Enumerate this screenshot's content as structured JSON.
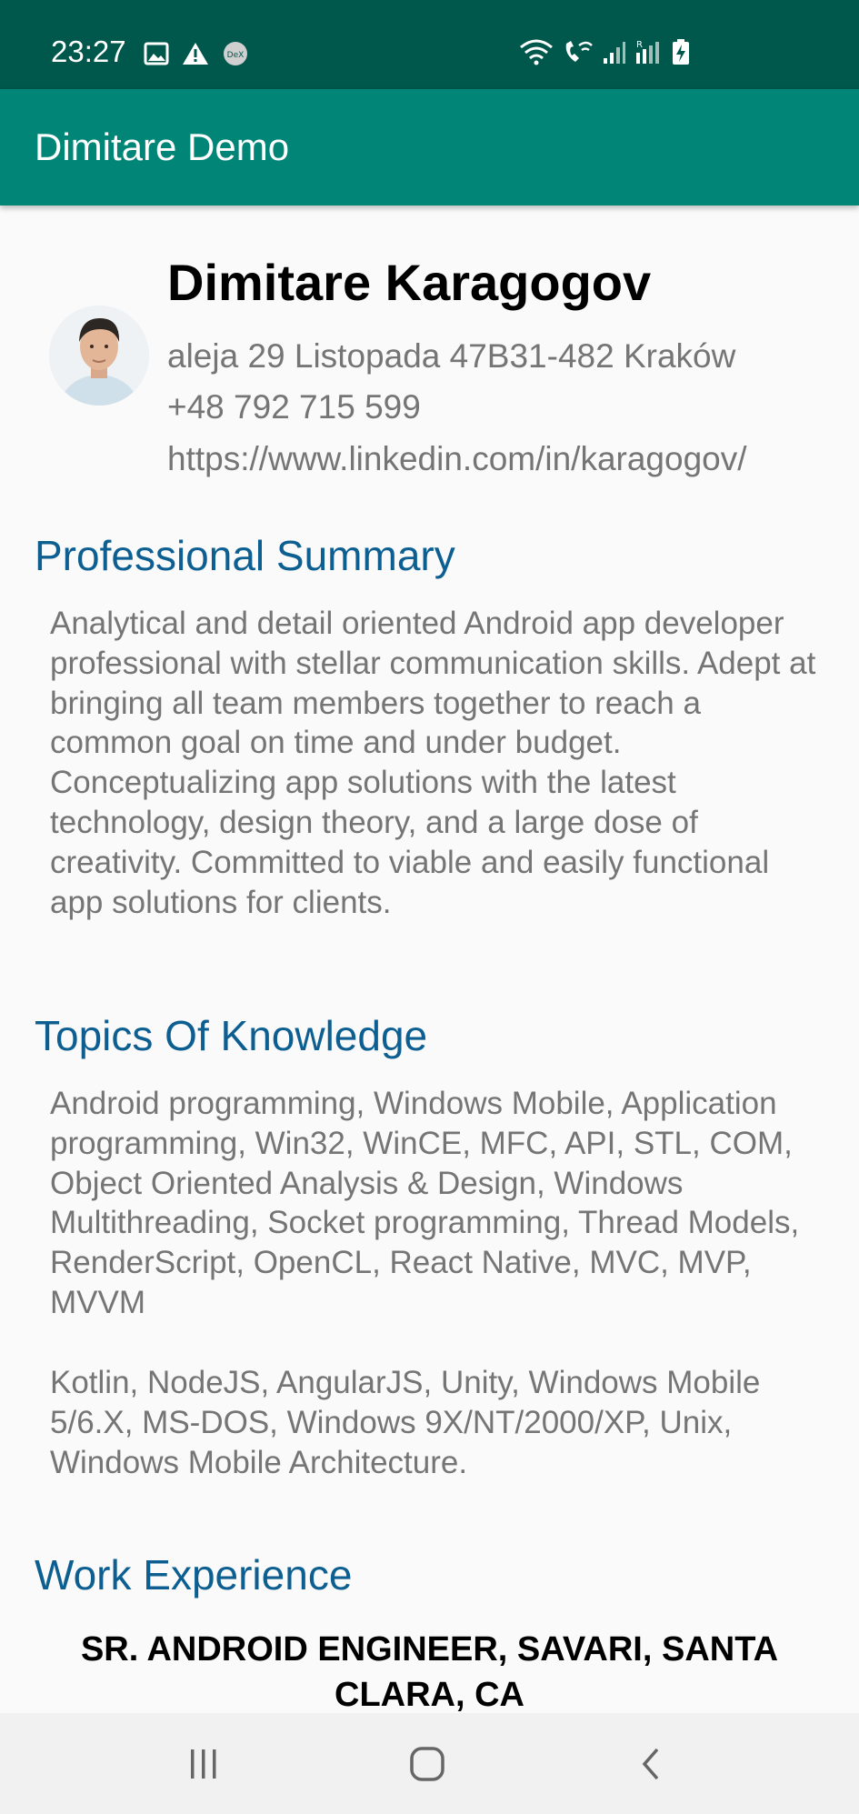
{
  "status_bar": {
    "time": "23:27",
    "left_icons": [
      "image-icon",
      "warning-icon",
      "dex-icon"
    ],
    "right_icons": [
      "wifi-icon",
      "wifi-call-icon",
      "signal-icon",
      "roaming-signal-icon",
      "battery-charging-icon"
    ]
  },
  "app_bar": {
    "title": "Dimitare Demo"
  },
  "profile": {
    "name": "Dimitare Karagogov",
    "address": "aleja 29 Listopada 47B31-482 Kraków",
    "phone": "+48 792 715 599",
    "linkedin": "https://www.linkedin.com/in/karagogov/"
  },
  "sections": {
    "summary": {
      "title": "Professional Summary",
      "text": "Analytical and detail oriented Android app developer professional with stellar communication skills. Adept at bringing all team members together to reach a common goal on time and under budget. Conceptualizing app solutions with the latest technology, design theory, and a large dose of creativity. Committed to viable and easily functional app solutions for clients."
    },
    "knowledge": {
      "title": "Topics Of Knowledge",
      "text1": "Android programming, Windows Mobile, Application programming, Win32, WinCE, MFC, API, STL, COM, Object Oriented Analysis & Design, Windows Multithreading, Socket programming, Thread Models, RenderScript, OpenCL, React Native, MVC, MVP, MVVM",
      "text2": "Kotlin, NodeJS, AngularJS, Unity, Windows Mobile 5/6.X, MS-DOS, Windows 9X/NT/2000/XP, Unix, Windows Mobile Architecture."
    },
    "work": {
      "title": "Work Experience",
      "job_title": "SR. ANDROID ENGINEER, SAVARI, SANTA CLARA, CA"
    }
  },
  "nav_bar": {
    "icons": [
      "recent-apps-icon",
      "home-icon",
      "back-icon"
    ]
  },
  "colors": {
    "status_bar": "#00574b",
    "app_bar": "#008577",
    "section_title": "#0d5f91",
    "body_text": "#757575"
  }
}
